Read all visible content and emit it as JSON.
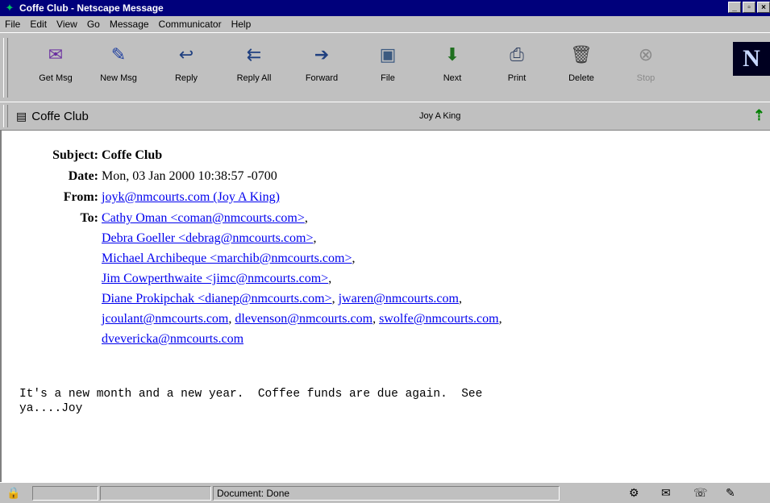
{
  "window": {
    "title": "Coffe Club - Netscape Message",
    "controls": [
      "_",
      "▫",
      "×"
    ]
  },
  "menu": [
    "File",
    "Edit",
    "View",
    "Go",
    "Message",
    "Communicator",
    "Help"
  ],
  "toolbar": [
    {
      "label": "Get Msg",
      "icon": "get-msg-icon",
      "glyph": "✉",
      "color": "#6a2ea0"
    },
    {
      "label": "New Msg",
      "icon": "new-msg-icon",
      "glyph": "✎",
      "color": "#2040a0"
    },
    {
      "label": "Reply",
      "icon": "reply-icon",
      "glyph": "↩",
      "color": "#204080"
    },
    {
      "label": "Reply All",
      "icon": "reply-all-icon",
      "glyph": "⇇",
      "color": "#204080"
    },
    {
      "label": "Forward",
      "icon": "forward-icon",
      "glyph": "➔",
      "color": "#204080"
    },
    {
      "label": "File",
      "icon": "file-icon",
      "glyph": "▣",
      "color": "#3c5a80"
    },
    {
      "label": "Next",
      "icon": "next-icon",
      "glyph": "⬇",
      "color": "#207020"
    },
    {
      "label": "Print",
      "icon": "print-icon",
      "glyph": "⎙",
      "color": "#304060"
    },
    {
      "label": "Delete",
      "icon": "delete-icon",
      "glyph": "🗑",
      "color": "#404040"
    },
    {
      "label": "Stop",
      "icon": "stop-icon",
      "glyph": "⊗",
      "color": "#8a8a8a",
      "disabled": true
    }
  ],
  "logo": "N",
  "message_bar": {
    "subject": "Coffe Club",
    "sender": "Joy A King"
  },
  "headers": {
    "subject_label": "Subject:",
    "subject": "Coffe Club",
    "date_label": "Date:",
    "date": "Mon, 03 Jan 2000 10:38:57 -0700",
    "from_label": "From:",
    "from": "joyk@nmcourts.com (Joy A King)",
    "to_label": "To:",
    "to": [
      [
        "Cathy Oman <coman@nmcourts.com>"
      ],
      [
        "Debra Goeller <debrag@nmcourts.com>"
      ],
      [
        "Michael Archibeque <marchib@nmcourts.com>"
      ],
      [
        "Jim Cowperthwaite <jimc@nmcourts.com>"
      ],
      [
        "Diane Prokipchak <dianep@nmcourts.com>",
        "jwaren@nmcourts.com"
      ],
      [
        "jcoulant@nmcourts.com",
        "dlevenson@nmcourts.com",
        "swolfe@nmcourts.com"
      ],
      [
        "dvevericka@nmcourts.com"
      ]
    ]
  },
  "body": "It's a new month and a new year.  Coffee funds are due again.  See\nya....Joy",
  "status": {
    "text": "Document: Done"
  }
}
